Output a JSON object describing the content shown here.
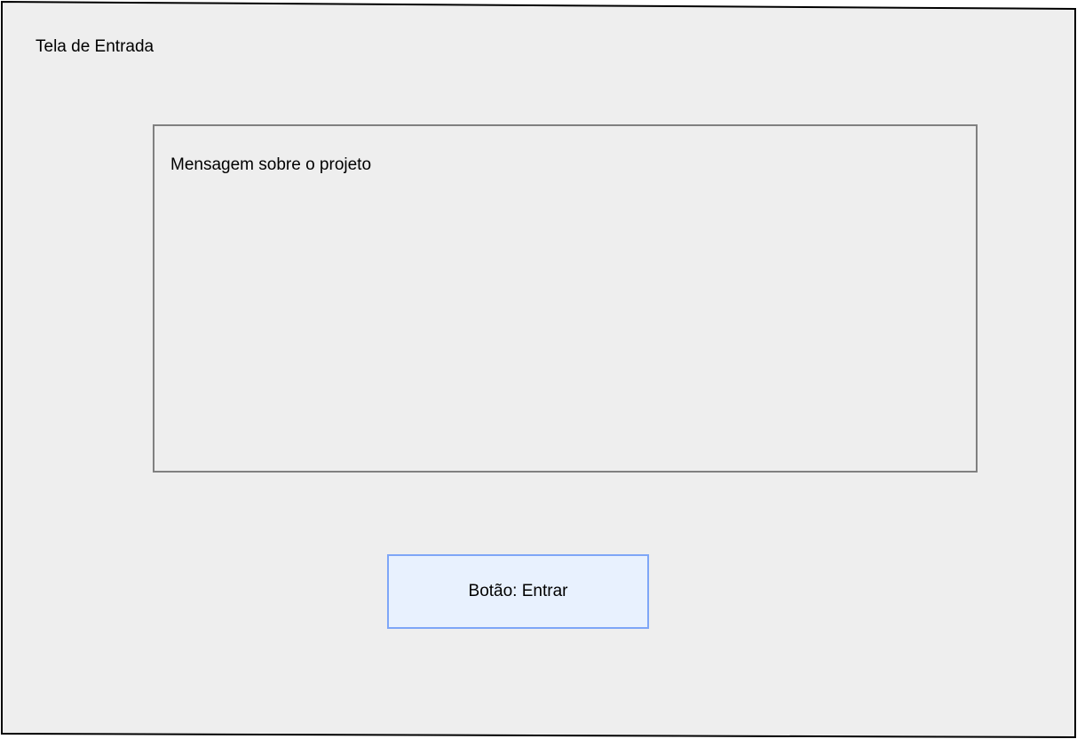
{
  "screen": {
    "title": "Tela de Entrada",
    "background_color": "#eeeeee"
  },
  "message_box": {
    "text": "Mensagem sobre o projeto",
    "border_color": "#808080"
  },
  "enter_button": {
    "label": "Botão: Entrar",
    "fill_color": "#e8f1fe",
    "border_color": "#7ea6f7"
  }
}
